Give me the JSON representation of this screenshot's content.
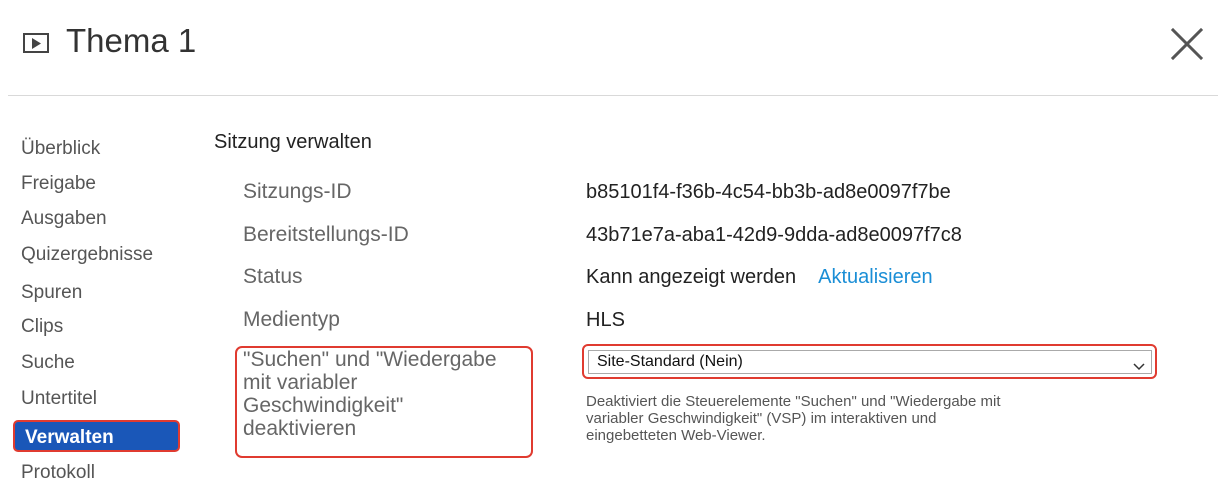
{
  "header": {
    "title": "Thema 1",
    "icon": "play-box-icon",
    "close_icon": "close-icon"
  },
  "nav": {
    "items": [
      {
        "label": "Überblick",
        "active": false
      },
      {
        "label": "Freigabe",
        "active": false
      },
      {
        "label": "Ausgaben",
        "active": false
      },
      {
        "label": "Quizergebnisse",
        "active": false
      },
      {
        "label": "Spuren",
        "active": false
      },
      {
        "label": "Clips",
        "active": false
      },
      {
        "label": "Suche",
        "active": false
      },
      {
        "label": "Untertitel",
        "active": false
      },
      {
        "label": "Verwalten",
        "active": true
      },
      {
        "label": "Protokoll",
        "active": false
      }
    ]
  },
  "main": {
    "section_title": "Sitzung verwalten",
    "session_id_label": "Sitzungs-ID",
    "session_id_value": "b85101f4-f36b-4c54-bb3b-ad8e0097f7be",
    "deployment_id_label": "Bereitstellungs-ID",
    "deployment_id_value": "43b71e7a-aba1-42d9-9dda-ad8e0097f7c8",
    "status_label": "Status",
    "status_value": "Kann angezeigt werden",
    "refresh_link": "Aktualisieren",
    "media_type_label": "Medientyp",
    "media_type_value": "HLS",
    "search_vsp_label": "\"Suchen\" und \"Wiedergabe mit variabler Geschwindigkeit\" deaktivieren",
    "search_vsp_label_lines": [
      "\"Suchen\" und \"Wiedergabe",
      "mit variabler",
      "Geschwindigkeit\"",
      "deaktivieren"
    ],
    "search_vsp_select_value": "Site-Standard (Nein)",
    "search_vsp_help_lines": [
      "Deaktiviert die Steuerelemente \"Suchen\" und \"Wiedergabe mit",
      "variabler Geschwindigkeit\" (VSP) im interaktiven und",
      "eingebetteten Web-Viewer."
    ]
  },
  "colors": {
    "active_nav_bg": "#1a57b8",
    "highlight_border": "#e03b30",
    "link": "#1a8ed6"
  }
}
